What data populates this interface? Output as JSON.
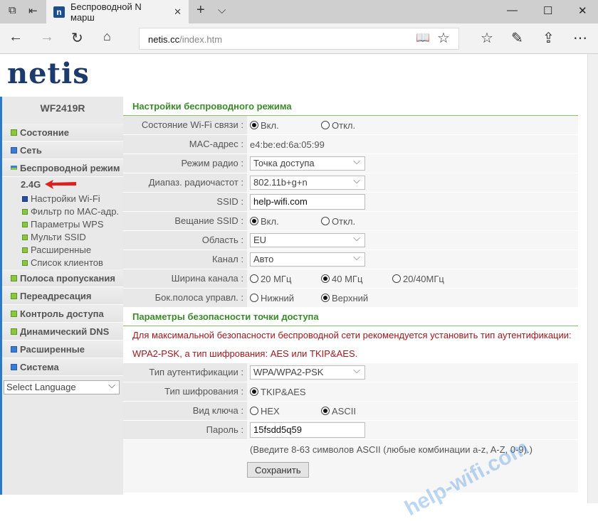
{
  "browser": {
    "tab_title": "Беспроводной N марш",
    "favicon": "n",
    "url_host": "netis.cc",
    "url_path": "/index.htm"
  },
  "logo": "netis",
  "sidebar": {
    "model": "WF2419R",
    "items": [
      {
        "label": "Состояние"
      },
      {
        "label": "Сеть"
      },
      {
        "label": "Беспроводной режим"
      }
    ],
    "band": "2.4G",
    "sub": [
      {
        "label": "Настройки Wi-Fi"
      },
      {
        "label": "Фильтр по MAC-адр."
      },
      {
        "label": "Параметры WPS"
      },
      {
        "label": "Мульти SSID"
      },
      {
        "label": "Расширенные"
      },
      {
        "label": "Список клиентов"
      }
    ],
    "items2": [
      {
        "label": "Полоса пропускания"
      },
      {
        "label": "Переадресация"
      },
      {
        "label": "Контроль доступа"
      },
      {
        "label": "Динамический DNS"
      },
      {
        "label": "Расширенные"
      },
      {
        "label": "Система"
      }
    ],
    "language": "Select Language"
  },
  "wireless": {
    "title": "Настройки беспроводного режима",
    "wifi_state_label": "Состояние Wi-Fi связи :",
    "on": "Вкл.",
    "off": "Откл.",
    "mac_label": "MAC-адрес :",
    "mac": "e4:be:ed:6a:05:99",
    "radio_mode_label": "Режим радио :",
    "radio_mode": "Точка доступа",
    "band_label": "Диапаз. радиочастот :",
    "band": "802.11b+g+n",
    "ssid_label": "SSID :",
    "ssid": "help-wifi.com",
    "broadcast_label": "Вещание SSID :",
    "region_label": "Область :",
    "region": "EU",
    "channel_label": "Канал :",
    "channel": "Авто",
    "width_label": "Ширина канала :",
    "w20": "20 МГц",
    "w40": "40 МГц",
    "w2040": "20/40МГц",
    "sideband_label": "Бок.полоса управл. :",
    "lower": "Нижний",
    "upper": "Верхний"
  },
  "security": {
    "title": "Параметры безопасности точки доступа",
    "warning1": "Для максимальной безопасности беспроводной сети рекомендуется установить тип аутентификации:",
    "warning2": "WPA2-PSK, а тип шифрования: AES или TKIP&AES.",
    "auth_label": "Тип аутентификации :",
    "auth": "WPA/WPA2-PSK",
    "enc_label": "Тип шифрования :",
    "enc": "TKIP&AES",
    "key_label": "Вид ключа :",
    "hex": "HEX",
    "ascii": "ASCII",
    "pass_label": "Пароль :",
    "pass": "15fsdd5q59",
    "hint": "(Введите 8-63 символов ASCII (любые комбинации a-z, A-Z, 0-9).)",
    "save": "Сохранить"
  },
  "watermark": "help-wifi.com"
}
